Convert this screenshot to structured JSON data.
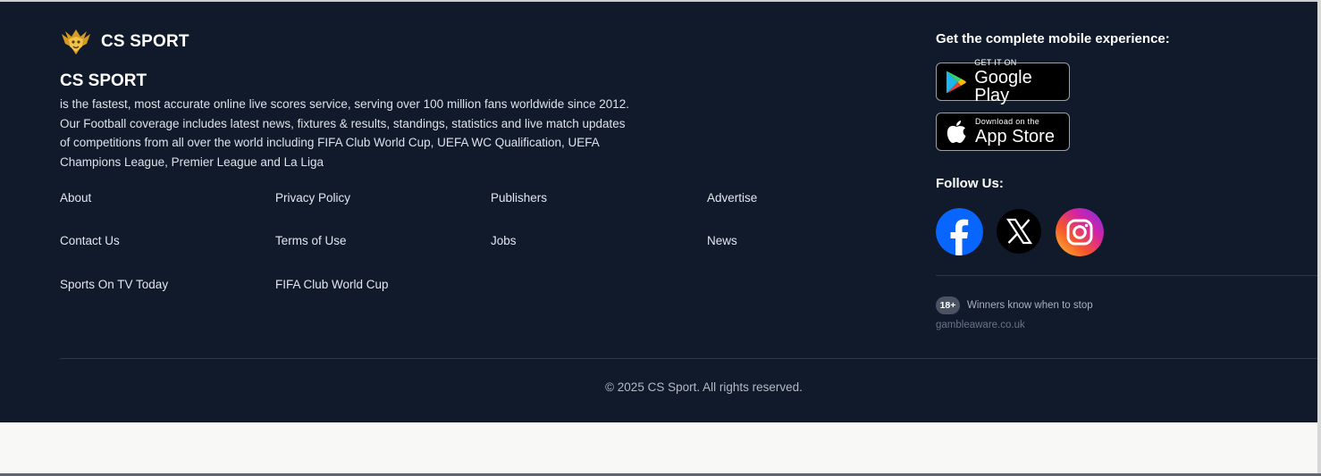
{
  "brand": {
    "logo_text": "CS SPORT",
    "logo_icon": "lion-crest-icon"
  },
  "about": {
    "title": "CS SPORT",
    "description": "is the fastest, most accurate online live scores service, serving over 100 million fans worldwide since 2012. Our Football coverage includes latest news, fixtures & results, standings, statistics and live match updates of competitions from all over the world including FIFA Club World Cup, UEFA WC Qualification, UEFA Champions League, Premier League and La Liga"
  },
  "links": {
    "about": "About",
    "privacy": "Privacy Policy",
    "publishers": "Publishers",
    "advertise": "Advertise",
    "contact": "Contact Us",
    "terms": "Terms of Use",
    "jobs": "Jobs",
    "news": "News",
    "sports_tv": "Sports On TV Today",
    "club_world_cup": "FIFA Club World Cup"
  },
  "mobile": {
    "title": "Get the complete mobile experience:",
    "google_small": "GET IT ON",
    "google_big": "Google Play",
    "apple_small": "Download on the",
    "apple_big": "App Store"
  },
  "follow": {
    "title": "Follow Us:",
    "icons": [
      "facebook-icon",
      "x-icon",
      "instagram-icon"
    ]
  },
  "responsible": {
    "age_badge": "18+",
    "message": "Winners know when to stop",
    "link": "gambleaware.co.uk"
  },
  "copyright": "© 2025 CS Sport. All rights reserved.",
  "colors": {
    "footer_bg": "#111a2b",
    "page_bg": "#f8f8f6",
    "facebook_blue": "#0866ff"
  }
}
